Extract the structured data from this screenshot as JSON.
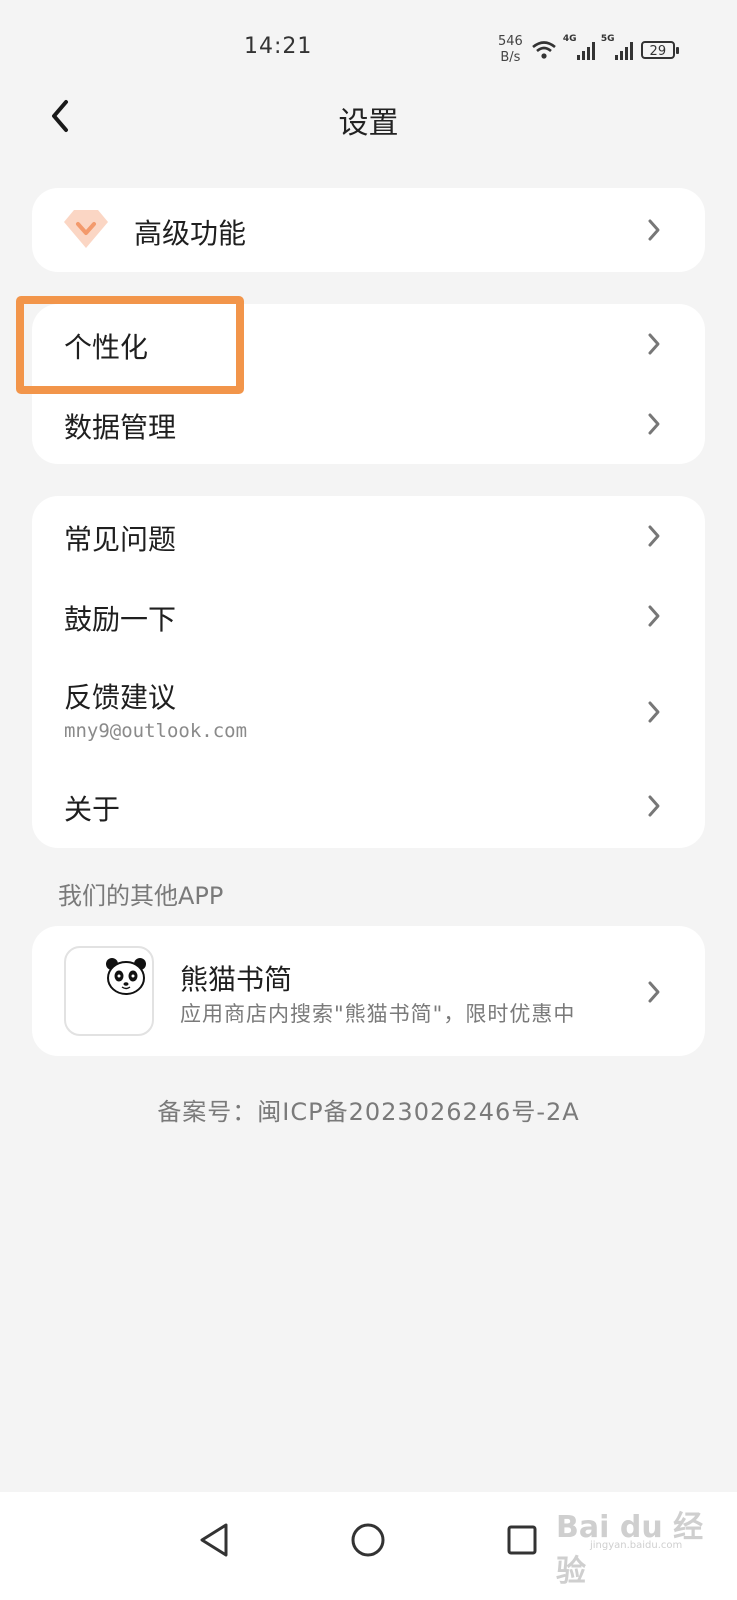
{
  "status_bar": {
    "time": "14:21",
    "net_speed_value": "546",
    "net_speed_unit": "B/s",
    "signal_1_tag": "4G",
    "signal_2_tag": "5G",
    "battery": "29"
  },
  "header": {
    "title": "设置",
    "back_icon": "chevron-left-icon"
  },
  "premium": {
    "icon": "diamond-icon",
    "icon_color": "#f6a079",
    "label": "高级功能"
  },
  "settings_group_1": [
    {
      "label": "个性化"
    },
    {
      "label": "数据管理"
    }
  ],
  "settings_group_2": [
    {
      "label": "常见问题"
    },
    {
      "label": "鼓励一下"
    },
    {
      "label": "反馈建议",
      "sub": "mny9@outlook.com"
    },
    {
      "label": "关于"
    }
  ],
  "other_apps": {
    "section_title": "我们的其他APP",
    "apps": [
      {
        "name": "熊猫书简",
        "desc": "应用商店内搜索\"熊猫书简\"，限时优惠中",
        "icon": "panda-icon"
      }
    ]
  },
  "icp": "备案号：闽ICP备2023026246号-2A",
  "highlight_color": "#f2954a",
  "watermark": {
    "logo": "Bai du 经验",
    "sub": "jingyan.baidu.com"
  }
}
